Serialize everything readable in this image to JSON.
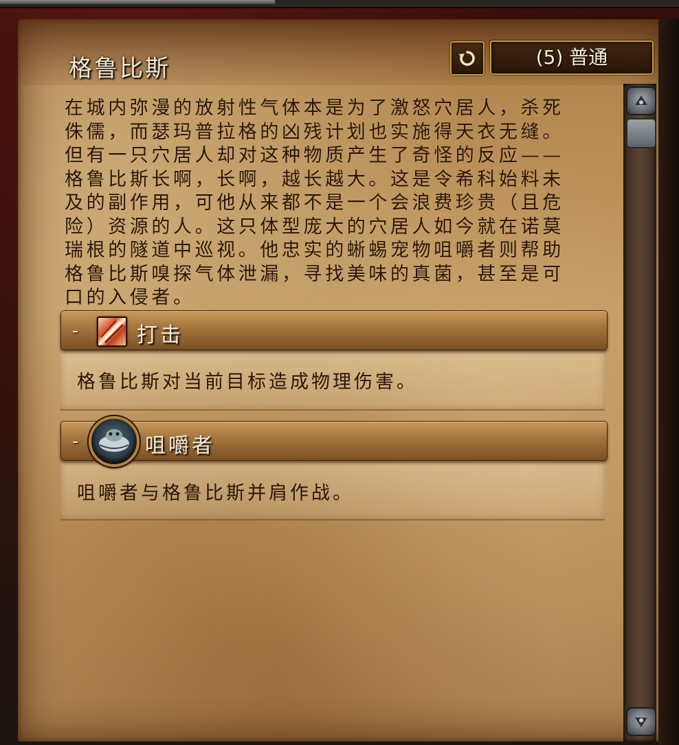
{
  "encounter": {
    "title": "格鲁比斯",
    "difficulty_label": "(5) 普通"
  },
  "description": [
    "在城内弥漫的放射性气体本是为了激怒穴居人，杀死",
    "侏儒，而瑟玛普拉格的凶残计划也实施得天衣无缝。",
    "但有一只穴居人却对这种物质产生了奇怪的反应——",
    "格鲁比斯长啊，长啊，越长越大。这是令希科始料未",
    "及的副作用，可他从来都不是一个会浪费珍贵（且危",
    "险）资源的人。这只体型庞大的穴居人如今就在诺莫",
    "瑞根的隧道中巡视。他忠实的蜥蜴宠物咀嚼者则帮助",
    "格鲁比斯嗅探气体泄漏，寻找美味的真菌，甚至是可",
    "口的入侵者。"
  ],
  "sections": [
    {
      "toggle": "-",
      "title": "打击",
      "text": "格鲁比斯对当前目标造成物理伤害。",
      "icon": "strike-icon"
    },
    {
      "toggle": "-",
      "title": "咀嚼者",
      "text": "咀嚼者与格鲁比斯并肩作战。",
      "icon": "pet-portrait-icon"
    }
  ],
  "icons": {
    "reset": "rotate-arrow-icon",
    "scroll_up": "scroll-up-icon",
    "scroll_down": "scroll-down-icon"
  },
  "colors": {
    "parchment": "#c29a62",
    "gold_border": "#c49a3b",
    "title_text": "#f2e6cf",
    "body_text": "#2a1608"
  }
}
